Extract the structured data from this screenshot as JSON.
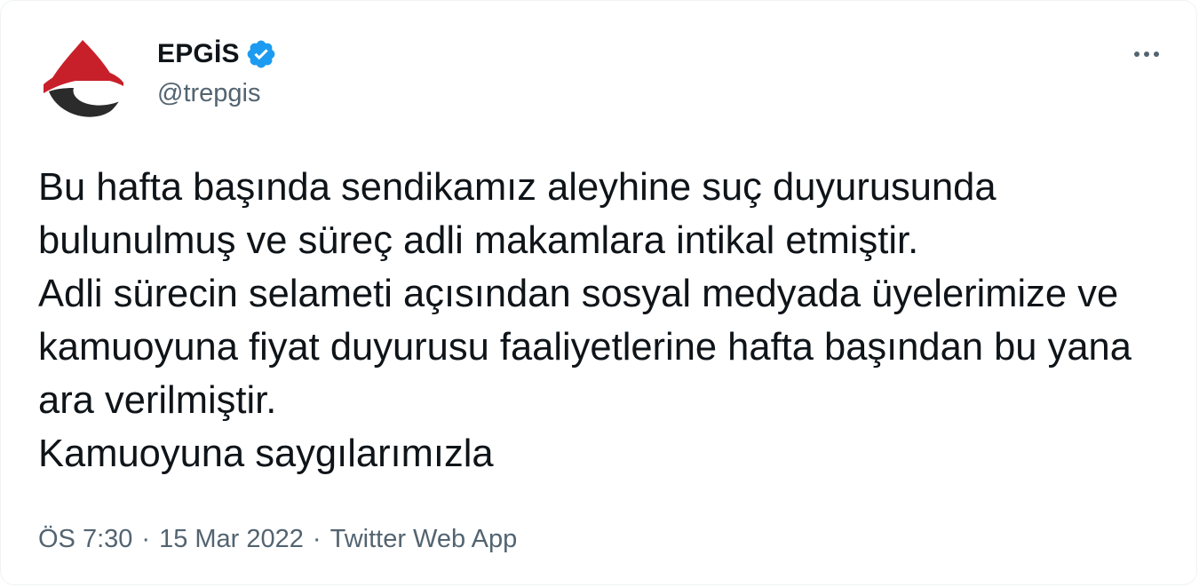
{
  "author": {
    "display_name": "EPGİS",
    "handle": "@trepgis",
    "verified": true
  },
  "tweet": {
    "text": "Bu hafta başında sendikamız aleyhine suç duyurusunda bulunulmuş ve süreç adli makamlara intikal etmiştir.\nAdli sürecin selameti açısından sosyal medyada üyelerimize ve kamuoyuna fiyat duyurusu faaliyetlerine hafta başından bu yana ara verilmiştir.\nKamuoyuna saygılarımızla"
  },
  "meta": {
    "time": "ÖS 7:30",
    "separator": "·",
    "date": "15 Mar 2022",
    "source": "Twitter Web App"
  },
  "icons": {
    "avatar": "epgis-logo",
    "verified": "verified-badge-icon",
    "more": "more-options-icon"
  },
  "colors": {
    "text": "#0f1419",
    "secondary": "#536471",
    "verified_blue": "#1d9bf0",
    "logo_red": "#c8202a",
    "logo_dark": "#2b2b2b"
  }
}
